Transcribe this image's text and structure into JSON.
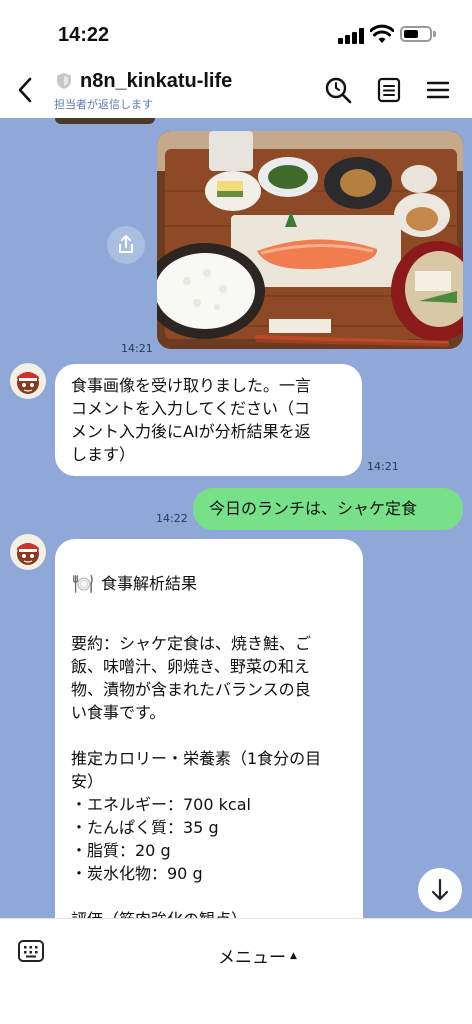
{
  "status_bar": {
    "time": "14:22"
  },
  "header": {
    "title": "n8n_kinkatu-life",
    "subtitle": "担当者が返信します",
    "icons": [
      "back-icon",
      "shield-icon",
      "search-icon",
      "notes-icon",
      "menu-icon"
    ]
  },
  "messages": {
    "photo_time": "14:21",
    "bot1_text": "食事画像を受け取りました。一言\nコメントを入力してください（コ\nメント入力後にAIが分析結果を返\nします）",
    "bot1_time": "14:21",
    "user_text": "今日のランチは、シャケ定食",
    "user_time": "14:22",
    "result_title": "食事解析結果",
    "result_body": "要約：シャケ定食は、焼き鮭、ご\n飯、味噌汁、卵焼き、野菜の和え\n物、漬物が含まれたバランスの良\nい食事です。\n\n推定カロリー・栄養素（1食分の目\n安）\n・エネルギー：700 kcal\n・たんぱく質：35 g\n・脂質：20 g\n・炭水化物：90 g\n\n評価（筋肉強化の観点）\n全体的に栄養バランスが良く、特"
  },
  "bottom_bar": {
    "menu_label": "メニュー",
    "menu_caret": "▲"
  },
  "colors": {
    "chat_bg": "#8fa8d8",
    "user_bubble": "#79e08a",
    "bot_bubble": "#ffffff"
  }
}
